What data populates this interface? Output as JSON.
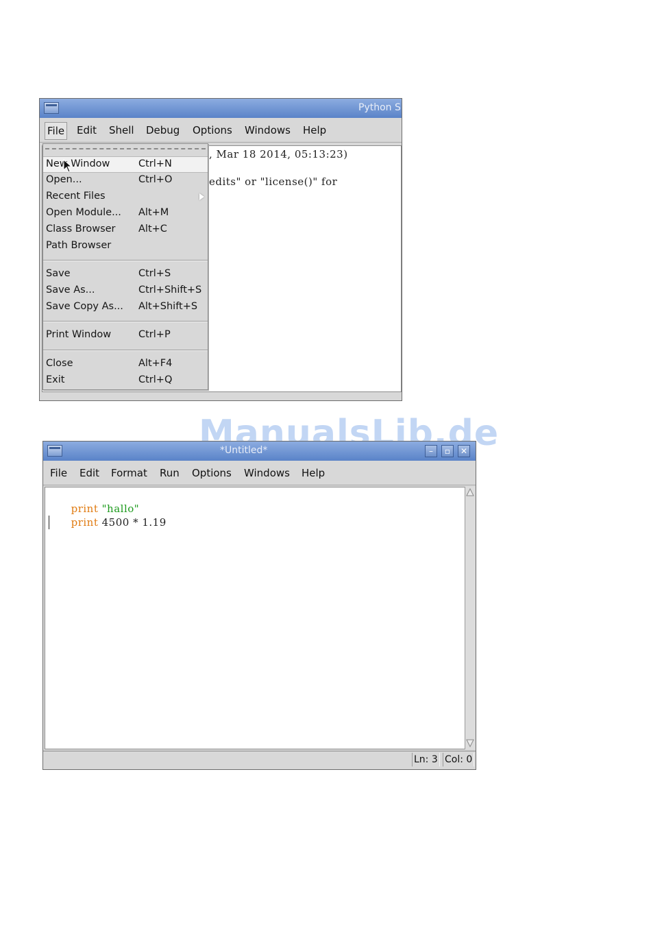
{
  "shell_window": {
    "title": "Python S",
    "menu": [
      "File",
      "Edit",
      "Shell",
      "Debug",
      "Options",
      "Windows",
      "Help"
    ],
    "output_lines": [
      ", Mar 18 2014, 05:13:23)",
      "edits\" or \"license()\" for"
    ]
  },
  "file_menu": {
    "items": [
      {
        "label": "New Window",
        "shortcut": "Ctrl+N"
      },
      {
        "label": "Open...",
        "shortcut": "Ctrl+O"
      },
      {
        "label": "Recent Files",
        "shortcut": ""
      },
      {
        "label": "Open Module...",
        "shortcut": "Alt+M"
      },
      {
        "label": "Class Browser",
        "shortcut": "Alt+C"
      },
      {
        "label": "Path Browser",
        "shortcut": ""
      },
      {
        "label": "Save",
        "shortcut": "Ctrl+S"
      },
      {
        "label": "Save As...",
        "shortcut": "Ctrl+Shift+S"
      },
      {
        "label": "Save Copy As...",
        "shortcut": "Alt+Shift+S"
      },
      {
        "label": "Print Window",
        "shortcut": "Ctrl+P"
      },
      {
        "label": "Close",
        "shortcut": "Alt+F4"
      },
      {
        "label": "Exit",
        "shortcut": "Ctrl+Q"
      }
    ],
    "highlighted": "New Window"
  },
  "editor_window": {
    "title": "*Untitled*",
    "menu": [
      "File",
      "Edit",
      "Format",
      "Run",
      "Options",
      "Windows",
      "Help"
    ],
    "code": [
      {
        "keyword": "print",
        "rest": "",
        "string": "\"hallo\""
      },
      {
        "keyword": "print",
        "rest": " 4500 * 1.19",
        "string": ""
      }
    ],
    "status": {
      "line": "Ln: 3",
      "col": "Col: 0"
    }
  },
  "watermark": "ManualsLib.de",
  "colors": {
    "keyword": "#e07b12",
    "string": "#1c9a1c",
    "titlebar": "#5a83c8"
  },
  "icons": [
    "window-menu-icon",
    "minimize-icon",
    "maximize-icon",
    "close-icon",
    "submenu-arrow-icon",
    "mouse-pointer-icon"
  ]
}
